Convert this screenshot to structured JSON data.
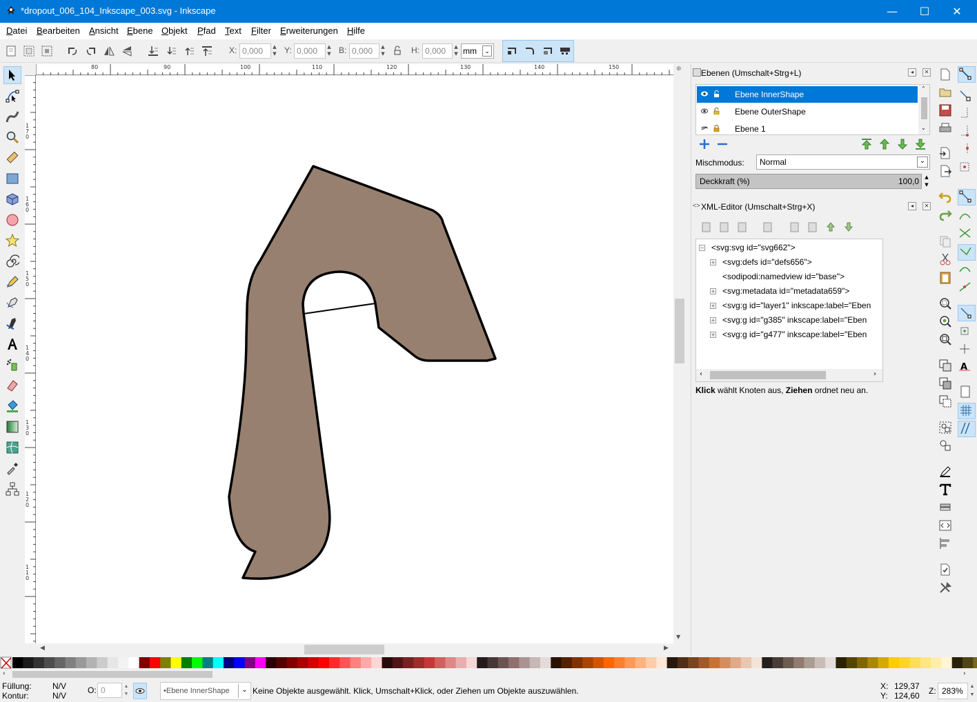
{
  "window": {
    "title": "*dropout_006_104_Inkscape_003.svg - Inkscape",
    "minimize": "—",
    "maximize": "☐",
    "close": "✕"
  },
  "menu": [
    "Datei",
    "Bearbeiten",
    "Ansicht",
    "Ebene",
    "Objekt",
    "Pfad",
    "Text",
    "Filter",
    "Erweiterungen",
    "Hilfe"
  ],
  "toolbar": {
    "x_label": "X:",
    "x_value": "0,000",
    "y_label": "Y:",
    "y_value": "0,000",
    "w_label": "B:",
    "w_value": "0,000",
    "h_label": "H:",
    "h_value": "0,000",
    "unit": "mm"
  },
  "ruler": {
    "top_labels": [
      "80",
      "90",
      "100",
      "110",
      "120",
      "130",
      "140",
      "150"
    ],
    "left_labels": [
      "170",
      "160",
      "150",
      "140",
      "130",
      "120",
      "110"
    ]
  },
  "layers_panel": {
    "title": "Ebenen (Umschalt+Strg+L)",
    "layers": [
      {
        "name": "Ebene InnerShape",
        "selected": true
      },
      {
        "name": "Ebene OuterShape",
        "selected": false
      },
      {
        "name": "Ebene 1",
        "selected": false
      }
    ],
    "blend_label": "Mischmodus:",
    "blend_value": "Normal",
    "opacity_label": "Deckkraft (%)",
    "opacity_value": "100,0"
  },
  "xml_panel": {
    "title": "XML-Editor (Umschalt+Strg+X)",
    "nodes": [
      {
        "text": "<svg:svg id=\"svg662\">",
        "expander": "⊟",
        "level": 0
      },
      {
        "text": "<svg:defs id=\"defs656\">",
        "expander": "⊞",
        "level": 1
      },
      {
        "text": "<sodipodi:namedview id=\"base\">",
        "expander": "",
        "level": 1
      },
      {
        "text": "<svg:metadata id=\"metadata659\">",
        "expander": "⊞",
        "level": 1
      },
      {
        "text": "<svg:g id=\"layer1\" inkscape:label=\"Eben",
        "expander": "⊞",
        "level": 1
      },
      {
        "text": "<svg:g id=\"g385\" inkscape:label=\"Eben",
        "expander": "⊞",
        "level": 1
      },
      {
        "text": "<svg:g id=\"g477\" inkscape:label=\"Eben",
        "expander": "⊞",
        "level": 1
      }
    ],
    "hint_bold1": "Klick",
    "hint_text1": " wählt Knoten aus, ",
    "hint_bold2": "Ziehen",
    "hint_text2": " ordnet neu an."
  },
  "status": {
    "fill_label": "Füllung:",
    "fill_value": "N/V",
    "stroke_label": "Kontur:",
    "stroke_value": "N/V",
    "opacity_label": "O:",
    "opacity_value": "0",
    "layer_value": "•Ebene InnerShape",
    "message": "Keine Objekte ausgewählt. Klick, Umschalt+Klick, oder Ziehen um Objekte auszuwählen.",
    "x_label": "X:",
    "x_value": "129,37",
    "y_label": "Y:",
    "y_value": "124,60",
    "zoom_label": "Z:",
    "zoom_value": "283%"
  },
  "colors": {
    "shape_fill": "#978070",
    "shape_stroke": "#000000",
    "accent": "#0078d7"
  }
}
